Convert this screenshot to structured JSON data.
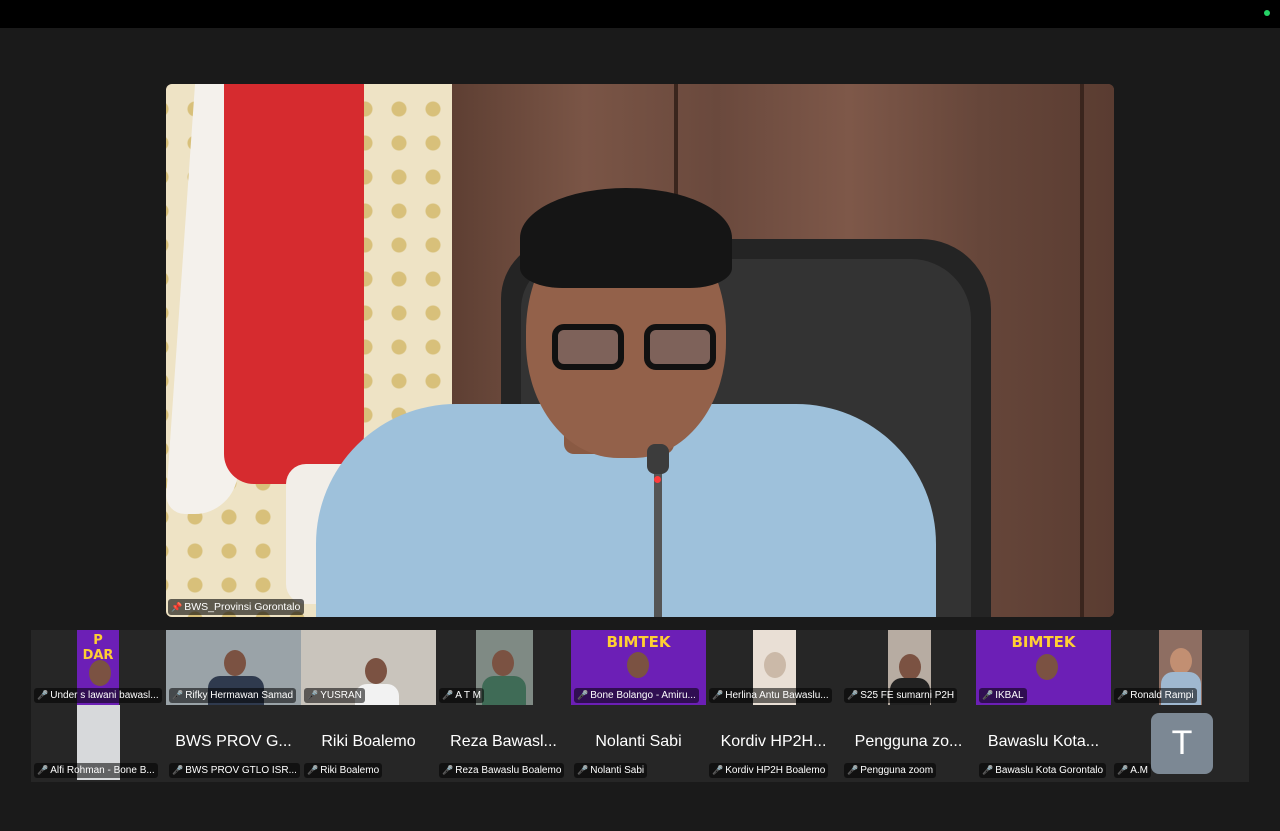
{
  "main": {
    "speaker_label": "BWS_Provinsi Gorontalo"
  },
  "participants_row1": [
    {
      "label": "Under s lawani bawasl...",
      "thumb": "banner-small"
    },
    {
      "label": "Rifky Hermawan Samad",
      "thumb": "face"
    },
    {
      "label": "YUSRAN",
      "thumb": "face"
    },
    {
      "label": "A T M",
      "thumb": "face"
    },
    {
      "label": "Bone Bolango - Amiru...",
      "thumb": "banner",
      "banner_text": "BIMTEK"
    },
    {
      "label": "Herlina Antu Bawaslu...",
      "thumb": "face"
    },
    {
      "label": "S25 FE sumarni P2H",
      "thumb": "face"
    },
    {
      "label": "IKBAL",
      "thumb": "banner",
      "banner_text": "BIMTEK"
    },
    {
      "label": "Ronald Rampi",
      "thumb": "face"
    }
  ],
  "participants_row2": [
    {
      "big": "",
      "label": "Alfi Rohman - Bone B...",
      "thumb": "face"
    },
    {
      "big": "BWS PROV G...",
      "label": "BWS PROV GTLO ISR..."
    },
    {
      "big": "Riki Boalemo",
      "label": "Riki Boalemo"
    },
    {
      "big": "Reza Bawasl...",
      "label": "Reza Bawaslu Boalemo"
    },
    {
      "big": "Nolanti Sabi",
      "label": "Nolanti Sabi"
    },
    {
      "big": "Kordiv HP2H...",
      "label": "Kordiv HP2H Boalemo"
    },
    {
      "big": "Pengguna zo...",
      "label": "Pengguna zoom"
    },
    {
      "big": "Bawaslu Kota...",
      "label": "Bawaslu Kota Gorontalo"
    },
    {
      "big": "",
      "label": "A.M"
    }
  ],
  "avatar_initial": "T",
  "icons": {
    "pin": "pin-icon",
    "muted": "muted-mic-icon"
  },
  "colors": {
    "muted": "#e8302f",
    "status": "#25d366",
    "banner": "#6c1fb6"
  }
}
